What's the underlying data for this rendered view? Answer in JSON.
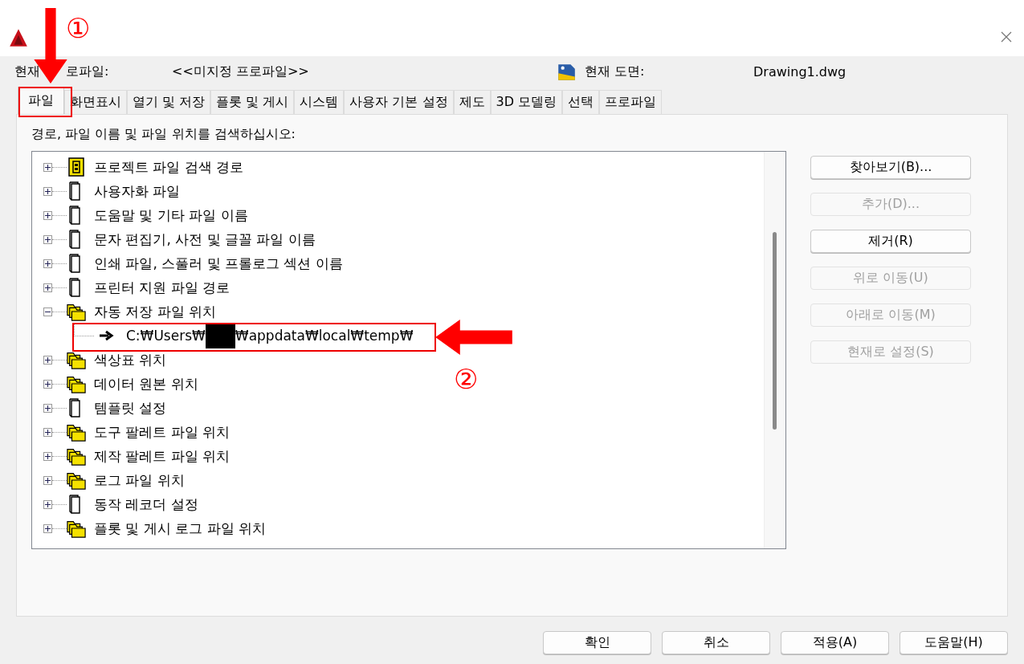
{
  "profile": {
    "label_parts": [
      "현재",
      "로파일:"
    ],
    "value": "<<미지정 프로파일>>"
  },
  "drawing": {
    "label": "현재 도면:",
    "value": "Drawing1.dwg"
  },
  "tabs": [
    {
      "label": "파일",
      "selected": true
    },
    {
      "label": "화면표시",
      "selected": false
    },
    {
      "label": "열기 및 저장",
      "selected": false
    },
    {
      "label": "플롯 및 게시",
      "selected": false
    },
    {
      "label": "시스템",
      "selected": false
    },
    {
      "label": "사용자 기본 설정",
      "selected": false
    },
    {
      "label": "제도",
      "selected": false
    },
    {
      "label": "3D 모델링",
      "selected": false
    },
    {
      "label": "선택",
      "selected": false
    },
    {
      "label": "프로파일",
      "selected": false
    }
  ],
  "tree_label": "경로, 파일 이름 및 파일 위치를 검색하십시오:",
  "tree": [
    {
      "label": "프로젝트 파일 검색 경로",
      "kind": "project",
      "expanded": false
    },
    {
      "label": "사용자화 파일",
      "kind": "file",
      "expanded": false
    },
    {
      "label": "도움말 및 기타 파일 이름",
      "kind": "file",
      "expanded": false
    },
    {
      "label": "문자 편집기, 사전 및 글꼴 파일 이름",
      "kind": "file",
      "expanded": false
    },
    {
      "label": "인쇄 파일, 스풀러 및 프롤로그 섹션 이름",
      "kind": "file",
      "expanded": false
    },
    {
      "label": "프린터 지원 파일 경로",
      "kind": "file",
      "expanded": false
    },
    {
      "label": "자동 저장 파일 위치",
      "kind": "folder",
      "expanded": true,
      "children": [
        {
          "path_start": "C:₩Users₩",
          "path_end": "₩appdata₩local₩temp₩",
          "redacted": true
        }
      ]
    },
    {
      "label": "색상표 위치",
      "kind": "folder",
      "expanded": false
    },
    {
      "label": "데이터 원본 위치",
      "kind": "folder",
      "expanded": false
    },
    {
      "label": "템플릿 설정",
      "kind": "file",
      "expanded": false
    },
    {
      "label": "도구 팔레트 파일 위치",
      "kind": "folder",
      "expanded": false
    },
    {
      "label": "제작 팔레트 파일 위치",
      "kind": "folder",
      "expanded": false
    },
    {
      "label": "로그 파일 위치",
      "kind": "folder",
      "expanded": false
    },
    {
      "label": "동작 레코더 설정",
      "kind": "file",
      "expanded": false
    },
    {
      "label": "플롯 및 게시 로그 파일 위치",
      "kind": "folder",
      "expanded": false
    }
  ],
  "side_buttons": [
    {
      "label": "찾아보기(B)...",
      "disabled": false
    },
    {
      "label": "추가(D)...",
      "disabled": true
    },
    {
      "label": "제거(R)",
      "disabled": false
    },
    {
      "label": "위로 이동(U)",
      "disabled": true
    },
    {
      "label": "아래로 이동(M)",
      "disabled": true
    },
    {
      "label": "현재로 설정(S)",
      "disabled": true
    }
  ],
  "footer_buttons": [
    "확인",
    "취소",
    "적용(A)",
    "도움말(H)"
  ],
  "annotations": [
    {
      "number": "①"
    },
    {
      "number": "②"
    }
  ]
}
